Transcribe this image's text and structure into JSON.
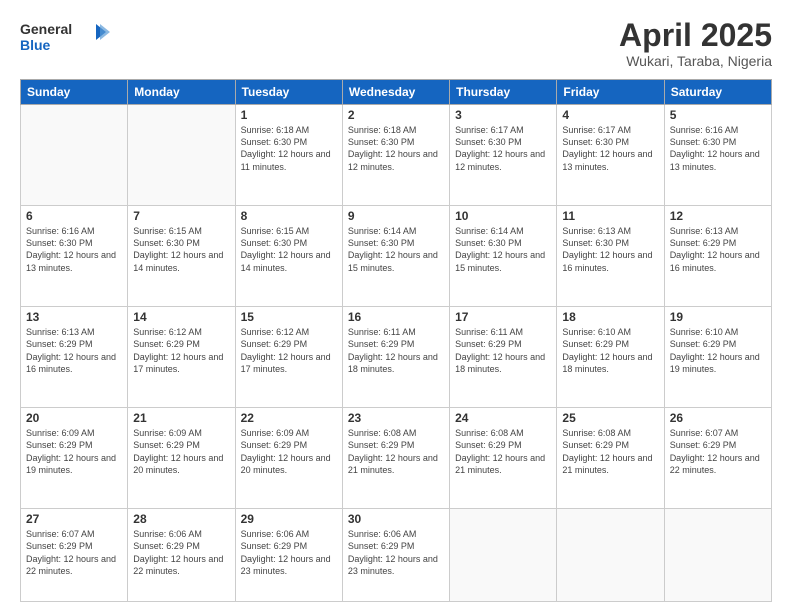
{
  "logo": {
    "general": "General",
    "blue": "Blue"
  },
  "title": "April 2025",
  "location": "Wukari, Taraba, Nigeria",
  "weekdays": [
    "Sunday",
    "Monday",
    "Tuesday",
    "Wednesday",
    "Thursday",
    "Friday",
    "Saturday"
  ],
  "weeks": [
    [
      {
        "day": "",
        "info": ""
      },
      {
        "day": "",
        "info": ""
      },
      {
        "day": "1",
        "info": "Sunrise: 6:18 AM\nSunset: 6:30 PM\nDaylight: 12 hours and 11 minutes."
      },
      {
        "day": "2",
        "info": "Sunrise: 6:18 AM\nSunset: 6:30 PM\nDaylight: 12 hours and 12 minutes."
      },
      {
        "day": "3",
        "info": "Sunrise: 6:17 AM\nSunset: 6:30 PM\nDaylight: 12 hours and 12 minutes."
      },
      {
        "day": "4",
        "info": "Sunrise: 6:17 AM\nSunset: 6:30 PM\nDaylight: 12 hours and 13 minutes."
      },
      {
        "day": "5",
        "info": "Sunrise: 6:16 AM\nSunset: 6:30 PM\nDaylight: 12 hours and 13 minutes."
      }
    ],
    [
      {
        "day": "6",
        "info": "Sunrise: 6:16 AM\nSunset: 6:30 PM\nDaylight: 12 hours and 13 minutes."
      },
      {
        "day": "7",
        "info": "Sunrise: 6:15 AM\nSunset: 6:30 PM\nDaylight: 12 hours and 14 minutes."
      },
      {
        "day": "8",
        "info": "Sunrise: 6:15 AM\nSunset: 6:30 PM\nDaylight: 12 hours and 14 minutes."
      },
      {
        "day": "9",
        "info": "Sunrise: 6:14 AM\nSunset: 6:30 PM\nDaylight: 12 hours and 15 minutes."
      },
      {
        "day": "10",
        "info": "Sunrise: 6:14 AM\nSunset: 6:30 PM\nDaylight: 12 hours and 15 minutes."
      },
      {
        "day": "11",
        "info": "Sunrise: 6:13 AM\nSunset: 6:30 PM\nDaylight: 12 hours and 16 minutes."
      },
      {
        "day": "12",
        "info": "Sunrise: 6:13 AM\nSunset: 6:29 PM\nDaylight: 12 hours and 16 minutes."
      }
    ],
    [
      {
        "day": "13",
        "info": "Sunrise: 6:13 AM\nSunset: 6:29 PM\nDaylight: 12 hours and 16 minutes."
      },
      {
        "day": "14",
        "info": "Sunrise: 6:12 AM\nSunset: 6:29 PM\nDaylight: 12 hours and 17 minutes."
      },
      {
        "day": "15",
        "info": "Sunrise: 6:12 AM\nSunset: 6:29 PM\nDaylight: 12 hours and 17 minutes."
      },
      {
        "day": "16",
        "info": "Sunrise: 6:11 AM\nSunset: 6:29 PM\nDaylight: 12 hours and 18 minutes."
      },
      {
        "day": "17",
        "info": "Sunrise: 6:11 AM\nSunset: 6:29 PM\nDaylight: 12 hours and 18 minutes."
      },
      {
        "day": "18",
        "info": "Sunrise: 6:10 AM\nSunset: 6:29 PM\nDaylight: 12 hours and 18 minutes."
      },
      {
        "day": "19",
        "info": "Sunrise: 6:10 AM\nSunset: 6:29 PM\nDaylight: 12 hours and 19 minutes."
      }
    ],
    [
      {
        "day": "20",
        "info": "Sunrise: 6:09 AM\nSunset: 6:29 PM\nDaylight: 12 hours and 19 minutes."
      },
      {
        "day": "21",
        "info": "Sunrise: 6:09 AM\nSunset: 6:29 PM\nDaylight: 12 hours and 20 minutes."
      },
      {
        "day": "22",
        "info": "Sunrise: 6:09 AM\nSunset: 6:29 PM\nDaylight: 12 hours and 20 minutes."
      },
      {
        "day": "23",
        "info": "Sunrise: 6:08 AM\nSunset: 6:29 PM\nDaylight: 12 hours and 21 minutes."
      },
      {
        "day": "24",
        "info": "Sunrise: 6:08 AM\nSunset: 6:29 PM\nDaylight: 12 hours and 21 minutes."
      },
      {
        "day": "25",
        "info": "Sunrise: 6:08 AM\nSunset: 6:29 PM\nDaylight: 12 hours and 21 minutes."
      },
      {
        "day": "26",
        "info": "Sunrise: 6:07 AM\nSunset: 6:29 PM\nDaylight: 12 hours and 22 minutes."
      }
    ],
    [
      {
        "day": "27",
        "info": "Sunrise: 6:07 AM\nSunset: 6:29 PM\nDaylight: 12 hours and 22 minutes."
      },
      {
        "day": "28",
        "info": "Sunrise: 6:06 AM\nSunset: 6:29 PM\nDaylight: 12 hours and 22 minutes."
      },
      {
        "day": "29",
        "info": "Sunrise: 6:06 AM\nSunset: 6:29 PM\nDaylight: 12 hours and 23 minutes."
      },
      {
        "day": "30",
        "info": "Sunrise: 6:06 AM\nSunset: 6:29 PM\nDaylight: 12 hours and 23 minutes."
      },
      {
        "day": "",
        "info": ""
      },
      {
        "day": "",
        "info": ""
      },
      {
        "day": "",
        "info": ""
      }
    ]
  ]
}
